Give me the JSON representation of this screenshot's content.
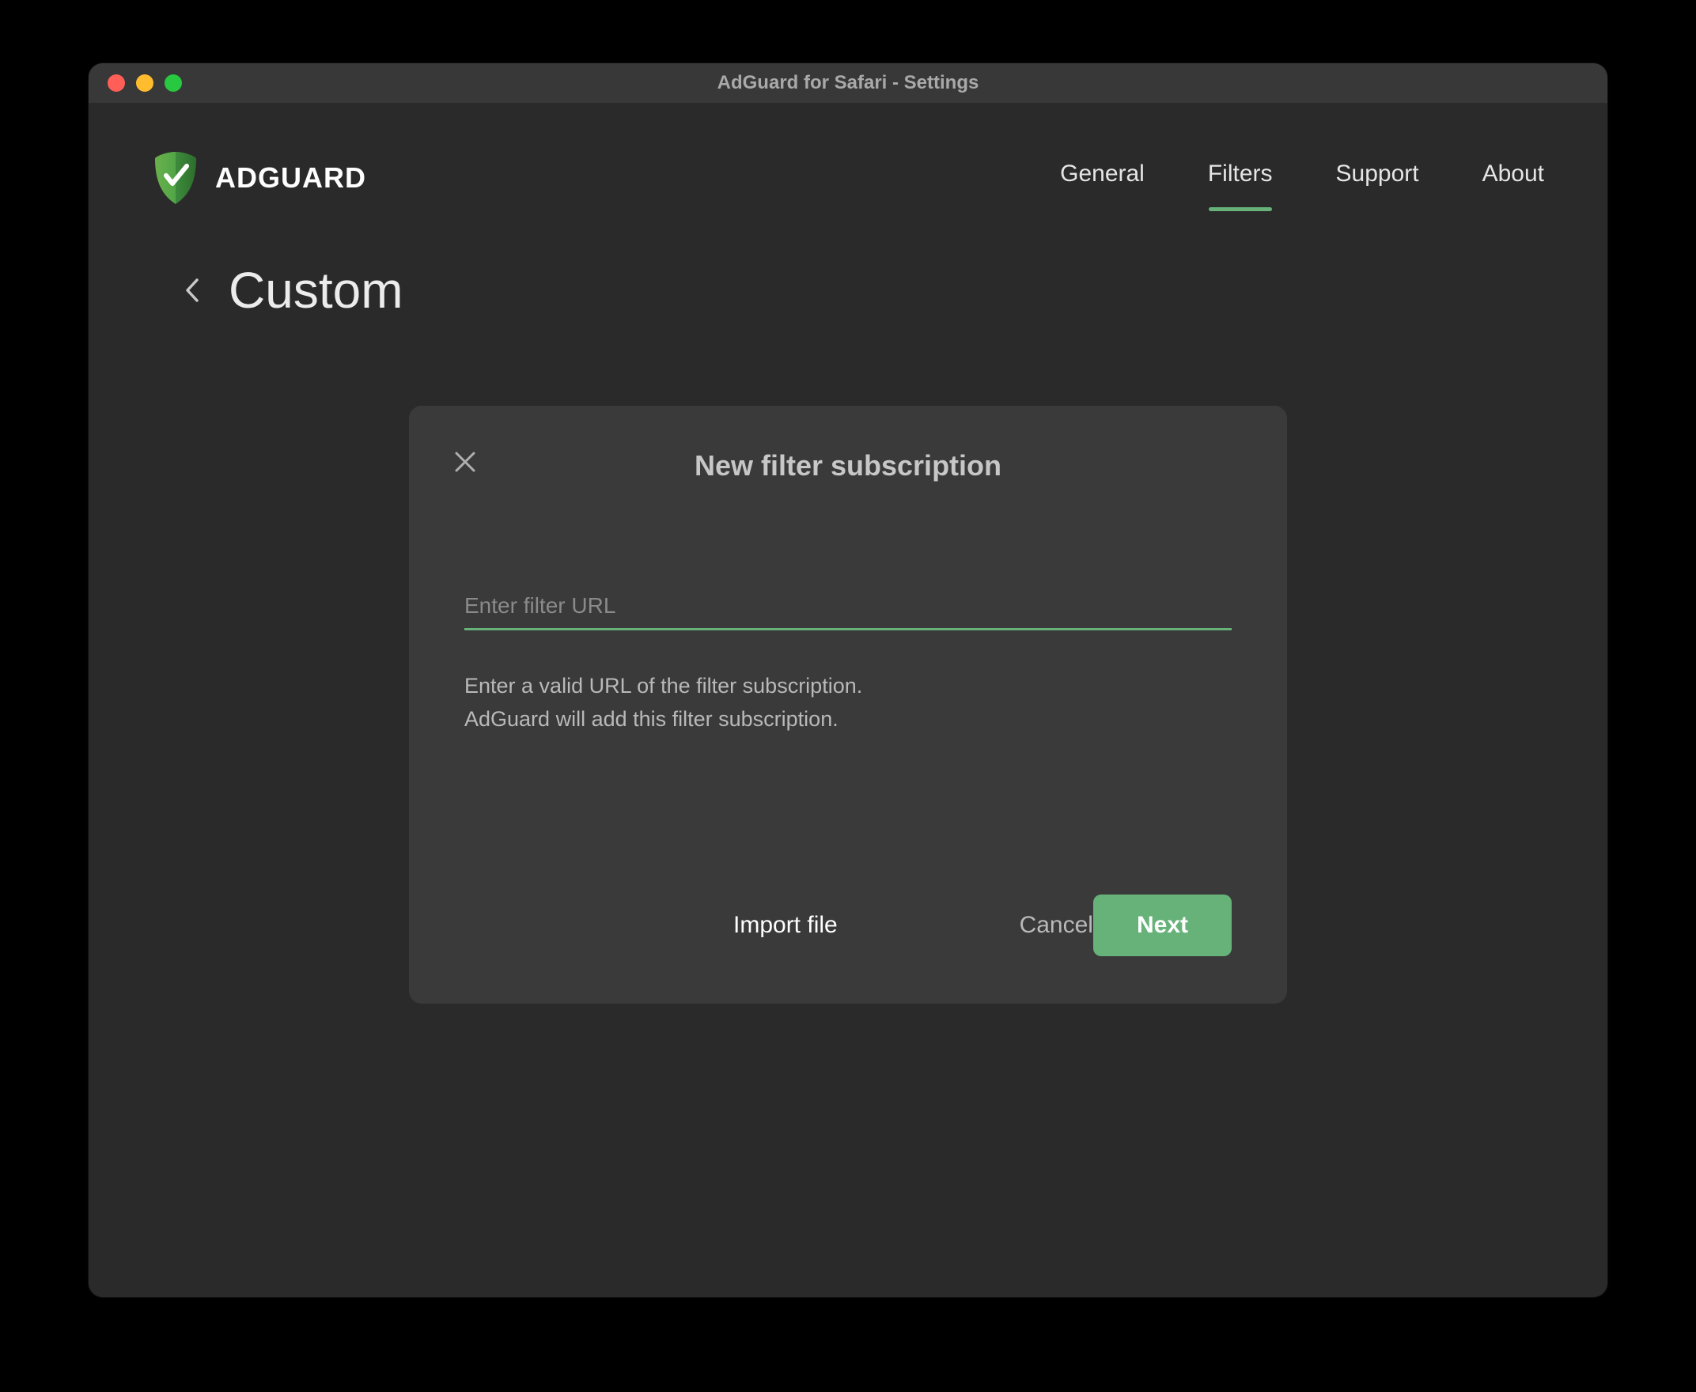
{
  "window": {
    "title": "AdGuard for Safari - Settings"
  },
  "brand": {
    "name": "ADGUARD"
  },
  "nav": {
    "items": [
      {
        "label": "General",
        "active": false
      },
      {
        "label": "Filters",
        "active": true
      },
      {
        "label": "Support",
        "active": false
      },
      {
        "label": "About",
        "active": false
      }
    ]
  },
  "page": {
    "title": "Custom"
  },
  "modal": {
    "title": "New filter subscription",
    "input_placeholder": "Enter filter URL",
    "input_value": "",
    "help_line1": "Enter a valid URL of the filter subscription.",
    "help_line2": "AdGuard will add this filter subscription.",
    "import_label": "Import file",
    "cancel_label": "Cancel",
    "next_label": "Next"
  },
  "colors": {
    "accent": "#67b279",
    "window_bg": "#2a2a2a",
    "modal_bg": "#3a3a3a"
  }
}
